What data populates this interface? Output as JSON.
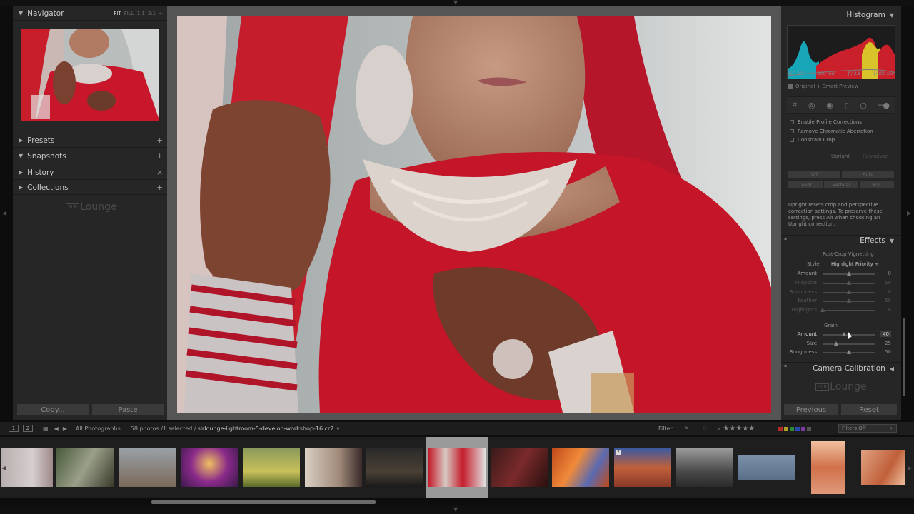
{
  "navigator": {
    "title": "Navigator",
    "zoom": [
      "FIT",
      "FILL",
      "1:1",
      "3:1"
    ]
  },
  "left_sections": [
    {
      "label": "Presets",
      "action": "+"
    },
    {
      "label": "Snapshots",
      "action": "+"
    },
    {
      "label": "History",
      "action": "×"
    },
    {
      "label": "Collections",
      "action": "+"
    }
  ],
  "brand": {
    "box": "SLR",
    "word": "Lounge"
  },
  "left_buttons": {
    "copy": "Copy...",
    "paste": "Paste"
  },
  "histogram": {
    "title": "Histogram",
    "iso": "ISO 800",
    "focal": "100 mm",
    "aperture": "ƒ / 2.8",
    "shutter": "1/200 sec",
    "preview": "Original + Smart Preview"
  },
  "lens": {
    "checks": [
      "Enable Profile Corrections",
      "Remove Chromatic Aberration",
      "Constrain Crop"
    ],
    "upright_label": "Upright",
    "reanalyze": "Reanalyze",
    "row1": [
      "Off",
      "Auto"
    ],
    "row2": [
      "Level",
      "Vertical",
      "Full"
    ],
    "help": "Upright resets crop and perspective correction settings. To preserve these settings, press Alt when choosing an Upright correction."
  },
  "effects": {
    "title": "Effects",
    "vignette_title": "Post-Crop Vignetting",
    "style_label": "Style",
    "style_value": "Highlight Priority ÷",
    "vignette_sliders": [
      {
        "label": "Amount",
        "value": "0",
        "pos": 0.5,
        "dim": false
      },
      {
        "label": "Midpoint",
        "value": "50",
        "pos": 0.5,
        "dim": true
      },
      {
        "label": "Roundness",
        "value": "0",
        "pos": 0.5,
        "dim": true
      },
      {
        "label": "Feather",
        "value": "50",
        "pos": 0.5,
        "dim": true
      },
      {
        "label": "Highlights",
        "value": "0",
        "pos": 0.0,
        "dim": true
      }
    ],
    "grain_title": "Grain",
    "grain_sliders": [
      {
        "label": "Amount",
        "value": "40",
        "pos": 0.4,
        "active": true
      },
      {
        "label": "Size",
        "value": "25",
        "pos": 0.25,
        "active": false
      },
      {
        "label": "Roughness",
        "value": "50",
        "pos": 0.5,
        "active": false
      }
    ]
  },
  "camera_calibration": "Camera Calibration",
  "right_buttons": {
    "previous": "Previous",
    "reset": "Reset"
  },
  "filmstrip_bar": {
    "pages": [
      "1",
      "2"
    ],
    "source": "All Photographs",
    "count": "58 photos /1 selected /",
    "filename": "slrlounge-lightroom-5-develop-workshop-16.cr2",
    "filter_label": "Filter :",
    "filters_off": "Filters Off"
  },
  "thumb_badge": "2",
  "colors": {
    "panel": "#262626",
    "accent": "#c9c9c9",
    "selected_cell": "#9a9a9a"
  }
}
